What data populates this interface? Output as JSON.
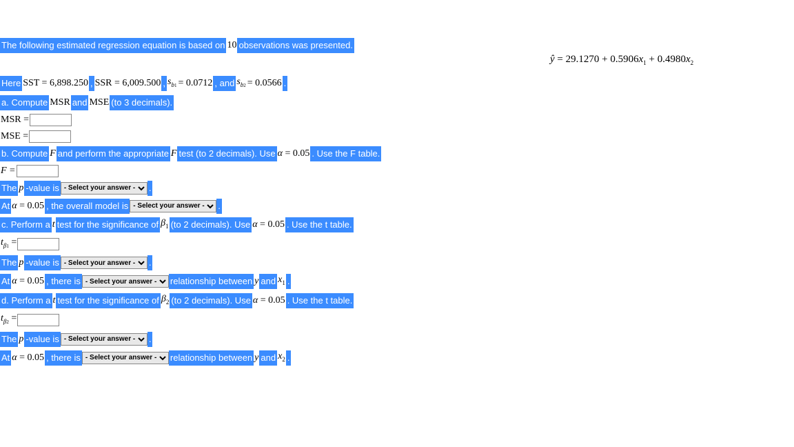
{
  "intro": {
    "prefix": "The following estimated regression equation is based on ",
    "n": "10",
    "suffix": " observations was presented."
  },
  "equation": "ŷ = 29.1270 + 0.5906x₁ + 0.4980x₂",
  "here_line": {
    "t1": "Here ",
    "sst": "SST = 6,898.250",
    "t2": ", ",
    "ssr": "SSR = 6,009.500",
    "t3": ", ",
    "sb1_lbl": "s_b₁",
    "sb1_val": " = 0.0712",
    "t4": ", and ",
    "sb2_lbl": "s_b₂",
    "sb2_val": " = 0.0566",
    "t5": "."
  },
  "a": {
    "t1": "a. Compute ",
    "msr": "MSR",
    "t2": " and ",
    "mse": "MSE",
    "t3": " (to 3 decimals).",
    "msr_lbl": "MSR =",
    "mse_lbl": "MSE ="
  },
  "b": {
    "t1": "b. Compute ",
    "F1": "F",
    "t2": " and perform the appropriate ",
    "F2": "F",
    "t3": " test (to 2 decimals). Use ",
    "alpha": "α = 0.05",
    "t4": ". Use the F table.",
    "F_lbl": "F =",
    "pval_t1": "The ",
    "pval_p": "p",
    "pval_t2": "-value is ",
    "pval_t3": " .",
    "model_t1": "At ",
    "model_alpha": "α = 0.05",
    "model_t2": ", the overall model is ",
    "model_t3": " ."
  },
  "c": {
    "t1": "c. Perform a ",
    "tsym": "t",
    "t2": " test for the significance of ",
    "beta": "β₁",
    "t3": " (to 2 decimals). Use ",
    "alpha": "α = 0.05",
    "t4": ". Use the t table.",
    "tbeta_lbl": "t_β₁ =",
    "pval_t1": "The ",
    "pval_p": "p",
    "pval_t2": "-value is ",
    "pval_t3": " .",
    "rel_t1": "At ",
    "rel_alpha": "α = 0.05",
    "rel_t2": ", there is ",
    "rel_t3": " relationship between ",
    "rel_y": "y",
    "rel_t4": " and ",
    "rel_x": "x₁",
    "rel_t5": "."
  },
  "d": {
    "t1": "d. Perform a ",
    "tsym": "t",
    "t2": " test for the significance of ",
    "beta": "β₂",
    "t3": " (to 2 decimals). Use ",
    "alpha": "α = 0.05",
    "t4": ". Use the t table.",
    "tbeta_lbl": "t_β₂ =",
    "pval_t1": "The ",
    "pval_p": "p",
    "pval_t2": "-value is ",
    "pval_t3": " .",
    "rel_t1": "At ",
    "rel_alpha": "α = 0.05",
    "rel_t2": ", there is ",
    "rel_t3": " relationship between ",
    "rel_y": "y",
    "rel_t4": " and ",
    "rel_x": "x₂",
    "rel_t5": "."
  },
  "select_placeholder": "- Select your answer -"
}
